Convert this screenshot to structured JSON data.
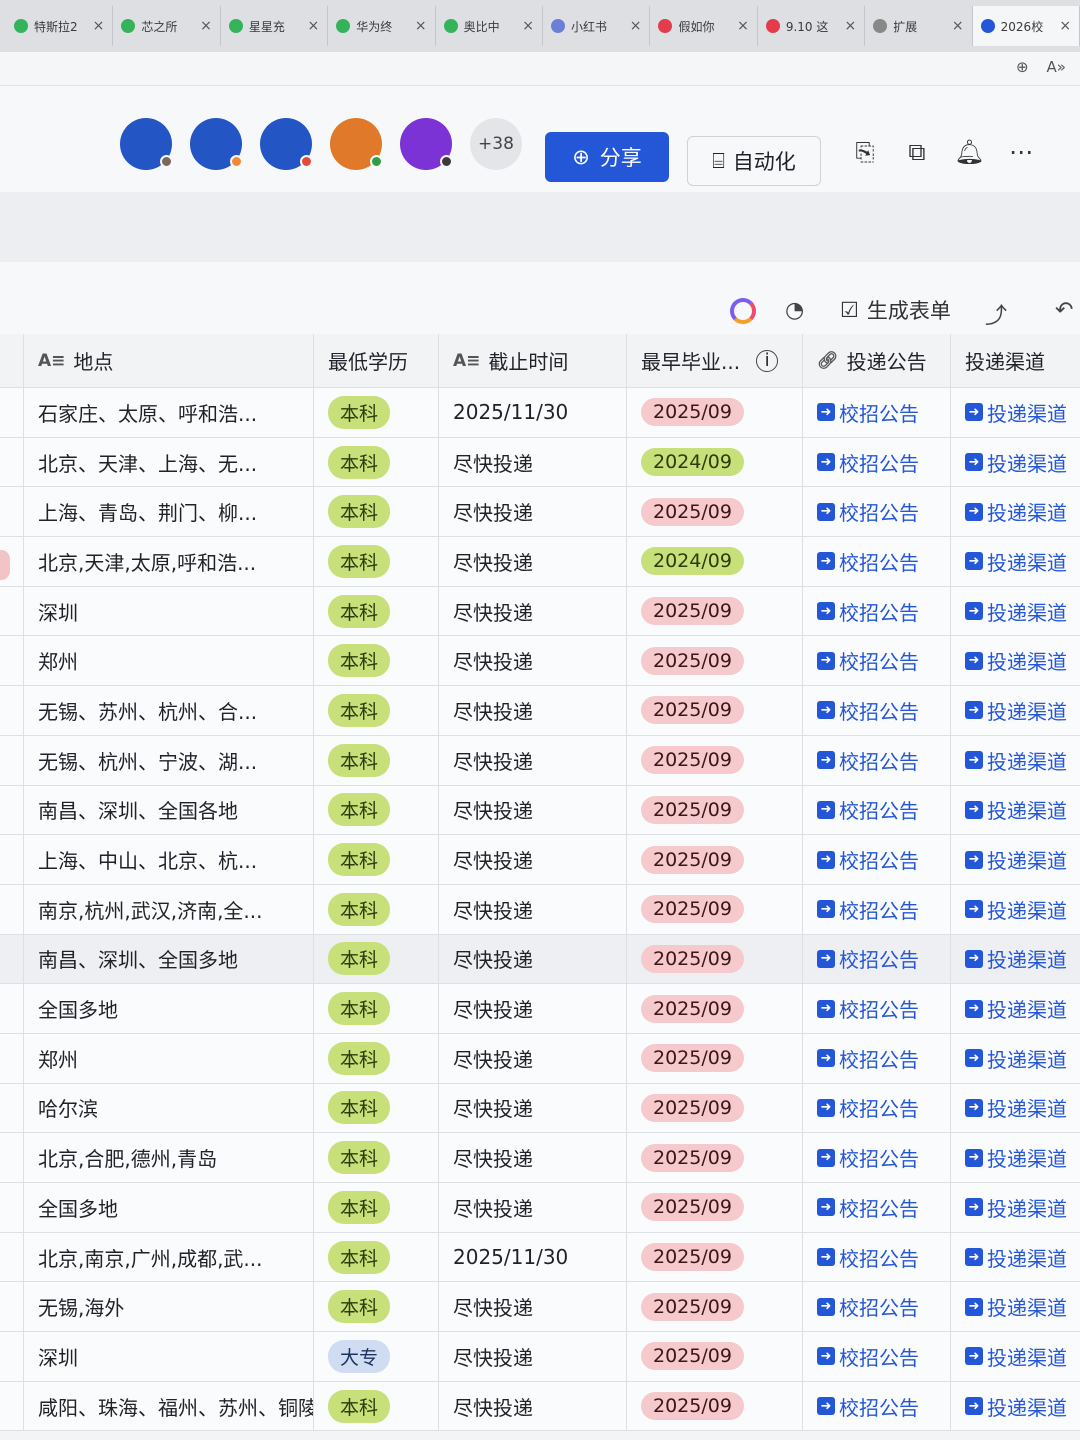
{
  "browser": {
    "tabs": [
      {
        "title": "特斯拉2",
        "color": "#34b35a"
      },
      {
        "title": "芯之所",
        "color": "#34b35a"
      },
      {
        "title": "星星充",
        "color": "#34b35a"
      },
      {
        "title": "华为终",
        "color": "#34b35a"
      },
      {
        "title": "奥比中",
        "color": "#34b35a"
      },
      {
        "title": "小红书",
        "color": "#6b7fd8"
      },
      {
        "title": "假如你",
        "color": "#e43c4a"
      },
      {
        "title": "9.10 这",
        "color": "#e43c4a"
      },
      {
        "title": "扩展",
        "color": "#888888"
      },
      {
        "title": "2026校",
        "color": "#2456d8"
      }
    ],
    "close_glyph": "×",
    "tools": [
      "zoom-icon",
      "read-aloud-icon"
    ]
  },
  "header": {
    "avatars": [
      {
        "color": "#2355c5",
        "status": "#7a6a5a"
      },
      {
        "color": "#2355c5",
        "status": "#f08a3a"
      },
      {
        "color": "#2355c5",
        "status": "#e24a3a"
      },
      {
        "color": "#e07a2a",
        "status": "#2f9e44"
      },
      {
        "color": "#7b33d6",
        "status": "#3a3a3a"
      }
    ],
    "more_users": "+38",
    "share_label": "分享",
    "automation_label": "自动化"
  },
  "toolbar": {
    "form_label": "生成表单"
  },
  "table": {
    "columns": [
      "地点",
      "最低学历",
      "截止时间",
      "最早毕业...",
      "投递公告",
      "投递渠道"
    ],
    "link_notice": "校招公告",
    "link_channel": "投递渠道",
    "rows": [
      {
        "location": "石家庄、太原、呼和浩...",
        "edu": "本科",
        "deadline": "2025/11/30",
        "grad": "2025/09"
      },
      {
        "location": "北京、天津、上海、无...",
        "edu": "本科",
        "deadline": "尽快投递",
        "grad": "2024/09"
      },
      {
        "location": "上海、青岛、荆门、柳...",
        "edu": "本科",
        "deadline": "尽快投递",
        "grad": "2025/09"
      },
      {
        "location": "北京,天津,太原,呼和浩...",
        "edu": "本科",
        "deadline": "尽快投递",
        "grad": "2024/09"
      },
      {
        "location": "深圳",
        "edu": "本科",
        "deadline": "尽快投递",
        "grad": "2025/09"
      },
      {
        "location": "郑州",
        "edu": "本科",
        "deadline": "尽快投递",
        "grad": "2025/09"
      },
      {
        "location": "无锡、苏州、杭州、合...",
        "edu": "本科",
        "deadline": "尽快投递",
        "grad": "2025/09"
      },
      {
        "location": "无锡、杭州、宁波、湖...",
        "edu": "本科",
        "deadline": "尽快投递",
        "grad": "2025/09"
      },
      {
        "location": "南昌、深圳、全国各地",
        "edu": "本科",
        "deadline": "尽快投递",
        "grad": "2025/09"
      },
      {
        "location": "上海、中山、北京、杭...",
        "edu": "本科",
        "deadline": "尽快投递",
        "grad": "2025/09"
      },
      {
        "location": "南京,杭州,武汉,济南,全...",
        "edu": "本科",
        "deadline": "尽快投递",
        "grad": "2025/09"
      },
      {
        "location": "南昌、深圳、全国多地",
        "edu": "本科",
        "deadline": "尽快投递",
        "grad": "2025/09"
      },
      {
        "location": "全国多地",
        "edu": "本科",
        "deadline": "尽快投递",
        "grad": "2025/09"
      },
      {
        "location": "郑州",
        "edu": "本科",
        "deadline": "尽快投递",
        "grad": "2025/09"
      },
      {
        "location": "哈尔滨",
        "edu": "本科",
        "deadline": "尽快投递",
        "grad": "2025/09"
      },
      {
        "location": "北京,合肥,德州,青岛",
        "edu": "本科",
        "deadline": "尽快投递",
        "grad": "2025/09"
      },
      {
        "location": "全国多地",
        "edu": "本科",
        "deadline": "尽快投递",
        "grad": "2025/09"
      },
      {
        "location": "北京,南京,广州,成都,武...",
        "edu": "本科",
        "deadline": "2025/11/30",
        "grad": "2025/09"
      },
      {
        "location": "无锡,海外",
        "edu": "本科",
        "deadline": "尽快投递",
        "grad": "2025/09"
      },
      {
        "location": "深圳",
        "edu": "大专",
        "deadline": "尽快投递",
        "grad": "2025/09"
      },
      {
        "location": "咸阳、珠海、福州、苏州、铜陵",
        "edu": "本科",
        "deadline": "尽快投递",
        "grad": "2025/09"
      }
    ]
  }
}
